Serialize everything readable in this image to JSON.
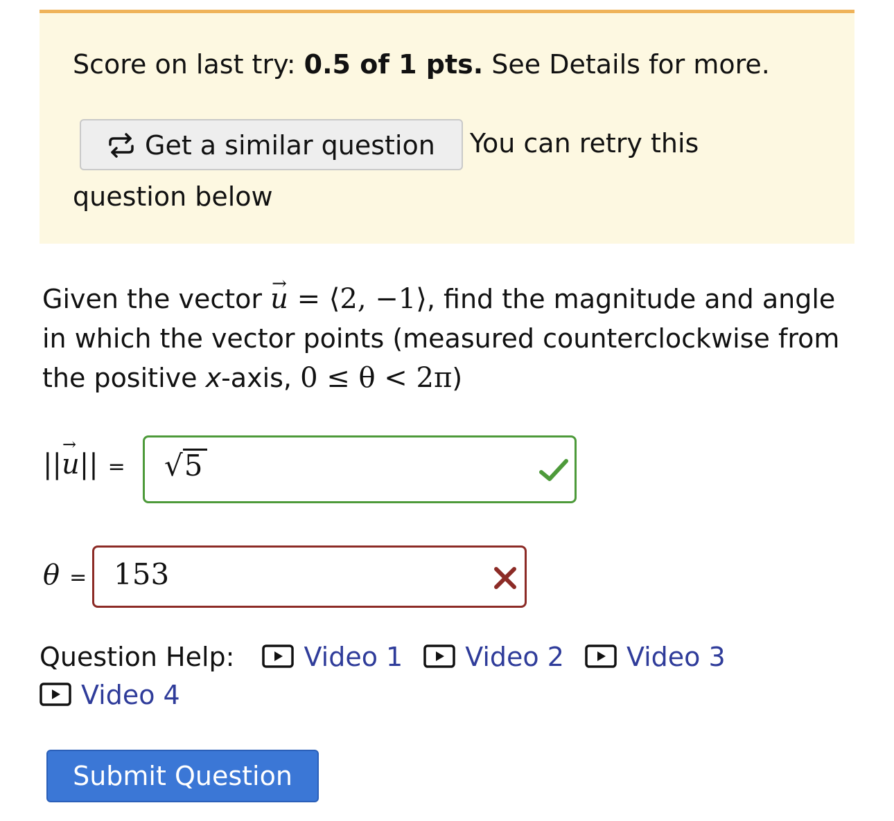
{
  "notice": {
    "score_prefix": "Score on last try: ",
    "score_value": "0.5 of 1 pts.",
    "score_suffix": " See Details for more.",
    "similar_button_label": "Get a similar question",
    "retry_text": "You can retry this",
    "retry_text_2": "question below",
    "icon": "repeat-icon",
    "background_color": "#fdf8e1",
    "border_color": "#efb35a"
  },
  "question": {
    "text_1": "Given the vector ",
    "vector_symbol": "u",
    "vector_value": " = ⟨2, −1⟩",
    "text_2": ", find the magnitude and angle in which the vector points (measured counterclockwise from the positive ",
    "x_var": "x",
    "text_3": "-axis, ",
    "range": "0 ≤ θ < 2π",
    "text_4": ")"
  },
  "answers": {
    "magnitude": {
      "label_left": "||",
      "label_symbol": "u",
      "label_right": "||",
      "equals": "=",
      "value": "5",
      "status": "correct",
      "status_icon": "checkmark-icon",
      "status_color": "#4d9a3a"
    },
    "angle": {
      "label": "θ",
      "equals": "=",
      "value": "153",
      "status": "incorrect",
      "status_icon": "x-mark-icon",
      "status_color": "#8c2b26"
    }
  },
  "help": {
    "label": "Question Help:",
    "videos": [
      "Video 1",
      "Video 2",
      "Video 3",
      "Video 4"
    ],
    "link_color": "#2f3c9a",
    "icon": "play-icon"
  },
  "submit": {
    "label": "Submit Question",
    "color": "#3b77d6"
  }
}
